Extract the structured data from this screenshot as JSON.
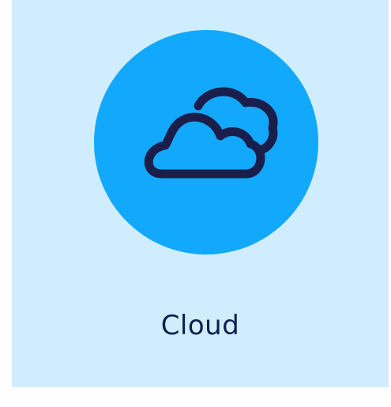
{
  "tile": {
    "label": "Cloud",
    "icon": "cloud-icon",
    "colors": {
      "background": "#d0edff",
      "circle": "#12a8fc",
      "icon_stroke": "#1a1e4a",
      "label": "#0d1f4f"
    }
  }
}
